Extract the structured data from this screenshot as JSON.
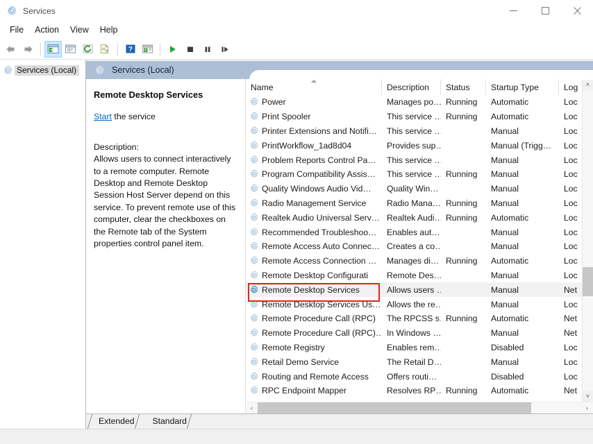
{
  "window": {
    "title": "Services",
    "icon": "services-gear-icon",
    "controls": {
      "minimize": "─",
      "maximize": "☐",
      "close": "✕"
    }
  },
  "menubar": {
    "items": [
      "File",
      "Action",
      "View",
      "Help"
    ]
  },
  "toolbar": {
    "groups": [
      [
        {
          "name": "back-icon",
          "glyph": "←"
        },
        {
          "name": "forward-icon",
          "glyph": "→"
        }
      ],
      [
        {
          "name": "show-hide-console-tree-icon",
          "pressed": true
        },
        {
          "name": "properties-icon",
          "pressed": false
        },
        {
          "name": "refresh-icon",
          "pressed": false
        },
        {
          "name": "export-list-icon",
          "pressed": false
        }
      ],
      [
        {
          "name": "help-icon",
          "pressed": false
        },
        {
          "name": "show-action-pane-icon",
          "pressed": false
        }
      ],
      [
        {
          "name": "start-service-icon",
          "glyph": "▶"
        },
        {
          "name": "stop-service-icon",
          "glyph": "■"
        },
        {
          "name": "pause-service-icon",
          "glyph": "▐▌"
        },
        {
          "name": "restart-service-icon",
          "glyph": "▐▶"
        }
      ]
    ]
  },
  "tree": {
    "root_label": "Services (Local)"
  },
  "pane_header": {
    "title": "Services (Local)"
  },
  "detail": {
    "service_name": "Remote Desktop Services",
    "start_link": "Start",
    "start_suffix": " the service",
    "description_label": "Description:",
    "description": "Allows users to connect interactively to a remote computer. Remote Desktop and Remote Desktop Session Host Server depend on this service. To prevent remote use of this computer, clear the checkboxes on the Remote tab of the System properties control panel item."
  },
  "list": {
    "columns": [
      {
        "key": "name",
        "label": "Name",
        "sorted": true
      },
      {
        "key": "desc",
        "label": "Description",
        "sorted": false
      },
      {
        "key": "status",
        "label": "Status",
        "sorted": false
      },
      {
        "key": "startup",
        "label": "Startup Type",
        "sorted": false
      },
      {
        "key": "logon",
        "label": "Log",
        "sorted": false
      }
    ],
    "rows": [
      {
        "name": "Power",
        "desc": "Manages po…",
        "status": "Running",
        "startup": "Automatic",
        "logon": "Loc",
        "selected": false,
        "highlighted": false
      },
      {
        "name": "Print Spooler",
        "desc": "This service …",
        "status": "Running",
        "startup": "Automatic",
        "logon": "Loc",
        "selected": false,
        "highlighted": false
      },
      {
        "name": "Printer Extensions and Notifi…",
        "desc": "This service …",
        "status": "",
        "startup": "Manual",
        "logon": "Loc",
        "selected": false,
        "highlighted": false
      },
      {
        "name": "PrintWorkflow_1ad8d04",
        "desc": "Provides sup…",
        "status": "",
        "startup": "Manual (Trigg…",
        "logon": "Loc",
        "selected": false,
        "highlighted": false
      },
      {
        "name": "Problem Reports Control Pa…",
        "desc": "This service …",
        "status": "",
        "startup": "Manual",
        "logon": "Loc",
        "selected": false,
        "highlighted": false
      },
      {
        "name": "Program Compatibility Assis…",
        "desc": "This service …",
        "status": "Running",
        "startup": "Manual",
        "logon": "Loc",
        "selected": false,
        "highlighted": false
      },
      {
        "name": "Quality Windows Audio Vid…",
        "desc": "Quality Win…",
        "status": "",
        "startup": "Manual",
        "logon": "Loc",
        "selected": false,
        "highlighted": false
      },
      {
        "name": "Radio Management Service",
        "desc": "Radio Mana…",
        "status": "Running",
        "startup": "Manual",
        "logon": "Loc",
        "selected": false,
        "highlighted": false
      },
      {
        "name": "Realtek Audio Universal Serv…",
        "desc": "Realtek Audi…",
        "status": "Running",
        "startup": "Automatic",
        "logon": "Loc",
        "selected": false,
        "highlighted": false
      },
      {
        "name": "Recommended Troubleshoo…",
        "desc": "Enables aut…",
        "status": "",
        "startup": "Manual",
        "logon": "Loc",
        "selected": false,
        "highlighted": false
      },
      {
        "name": "Remote Access Auto Connec…",
        "desc": "Creates a co…",
        "status": "",
        "startup": "Manual",
        "logon": "Loc",
        "selected": false,
        "highlighted": false
      },
      {
        "name": "Remote Access Connection …",
        "desc": "Manages di…",
        "status": "Running",
        "startup": "Automatic",
        "logon": "Loc",
        "selected": false,
        "highlighted": false
      },
      {
        "name": "Remote Desktop Configurati",
        "desc": "Remote Des…",
        "status": "",
        "startup": "Manual",
        "logon": "Loc",
        "selected": false,
        "highlighted": false
      },
      {
        "name": "Remote Desktop Services",
        "desc": "Allows users …",
        "status": "",
        "startup": "Manual",
        "logon": "Net",
        "selected": true,
        "highlighted": true
      },
      {
        "name": "Remote Desktop Services Us…",
        "desc": "Allows the re…",
        "status": "",
        "startup": "Manual",
        "logon": "Loc",
        "selected": false,
        "highlighted": false
      },
      {
        "name": "Remote Procedure Call (RPC)",
        "desc": "The RPCSS s…",
        "status": "Running",
        "startup": "Automatic",
        "logon": "Net",
        "selected": false,
        "highlighted": false
      },
      {
        "name": "Remote Procedure Call (RPC)…",
        "desc": "In Windows …",
        "status": "",
        "startup": "Manual",
        "logon": "Net",
        "selected": false,
        "highlighted": false
      },
      {
        "name": "Remote Registry",
        "desc": "Enables rem…",
        "status": "",
        "startup": "Disabled",
        "logon": "Loc",
        "selected": false,
        "highlighted": false
      },
      {
        "name": "Retail Demo Service",
        "desc": "The Retail D…",
        "status": "",
        "startup": "Manual",
        "logon": "Loc",
        "selected": false,
        "highlighted": false
      },
      {
        "name": "Routing and Remote Access",
        "desc": "Offers routi…",
        "status": "",
        "startup": "Disabled",
        "logon": "Loc",
        "selected": false,
        "highlighted": false
      },
      {
        "name": "RPC Endpoint Mapper",
        "desc": "Resolves RP…",
        "status": "Running",
        "startup": "Automatic",
        "logon": "Net",
        "selected": false,
        "highlighted": false
      }
    ]
  },
  "scrollbars": {
    "vertical": {
      "up": "˄",
      "down": "˅"
    },
    "horizontal": {
      "left": "‹",
      "right": "›"
    }
  },
  "tabs": [
    {
      "label": "Extended",
      "active": false
    },
    {
      "label": "Standard",
      "active": false
    }
  ],
  "colors": {
    "accent_header": "#adbfd6",
    "annotation": "#e22319",
    "link": "#0066cc",
    "selected_row": "#f2f2f2",
    "service_icon": "#3f97d4"
  }
}
